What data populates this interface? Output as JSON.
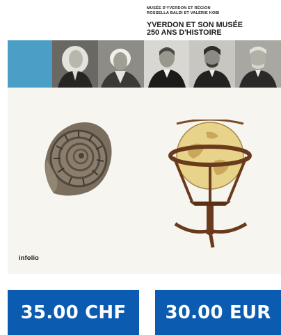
{
  "cover": {
    "museum_line1": "MUSÉE D'YVERDON ET RÉGION",
    "museum_line2": "ROSSELLA BALDI ET VALÉRIE KOBI",
    "title_line1": "YVERDON ET SON MUSÉE",
    "title_line2": "250 ANS D'HISTOIRE",
    "publisher": "infolio",
    "accent_color": "#4b9ec6"
  },
  "prices": {
    "chf_label": "35.00 CHF",
    "eur_label": "30.00 EUR",
    "button_color": "#0b5cb1"
  }
}
